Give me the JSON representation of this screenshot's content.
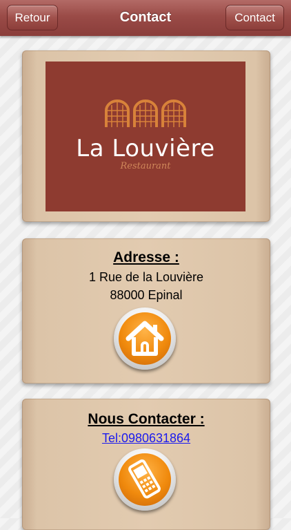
{
  "navbar": {
    "title": "Contact",
    "back_label": "Retour",
    "right_label": "Contact"
  },
  "logo": {
    "name": "La Louvière",
    "subtitle": "Restaurant",
    "panel_color": "#8e3b30",
    "accent_color": "#d0875a"
  },
  "address": {
    "heading": "Adresse :",
    "line1": "1 Rue de la Louvière",
    "line2": "88000 Epinal",
    "button_icon": "home-icon"
  },
  "contact": {
    "heading": "Nous Contacter :",
    "phone_link": "Tel:0980631864",
    "button_icon": "phone-icon"
  },
  "colors": {
    "navbar": "#9a4b47",
    "card": "#e2cbb0",
    "button_orange": "#f08a0d",
    "link": "#1a1aee"
  }
}
